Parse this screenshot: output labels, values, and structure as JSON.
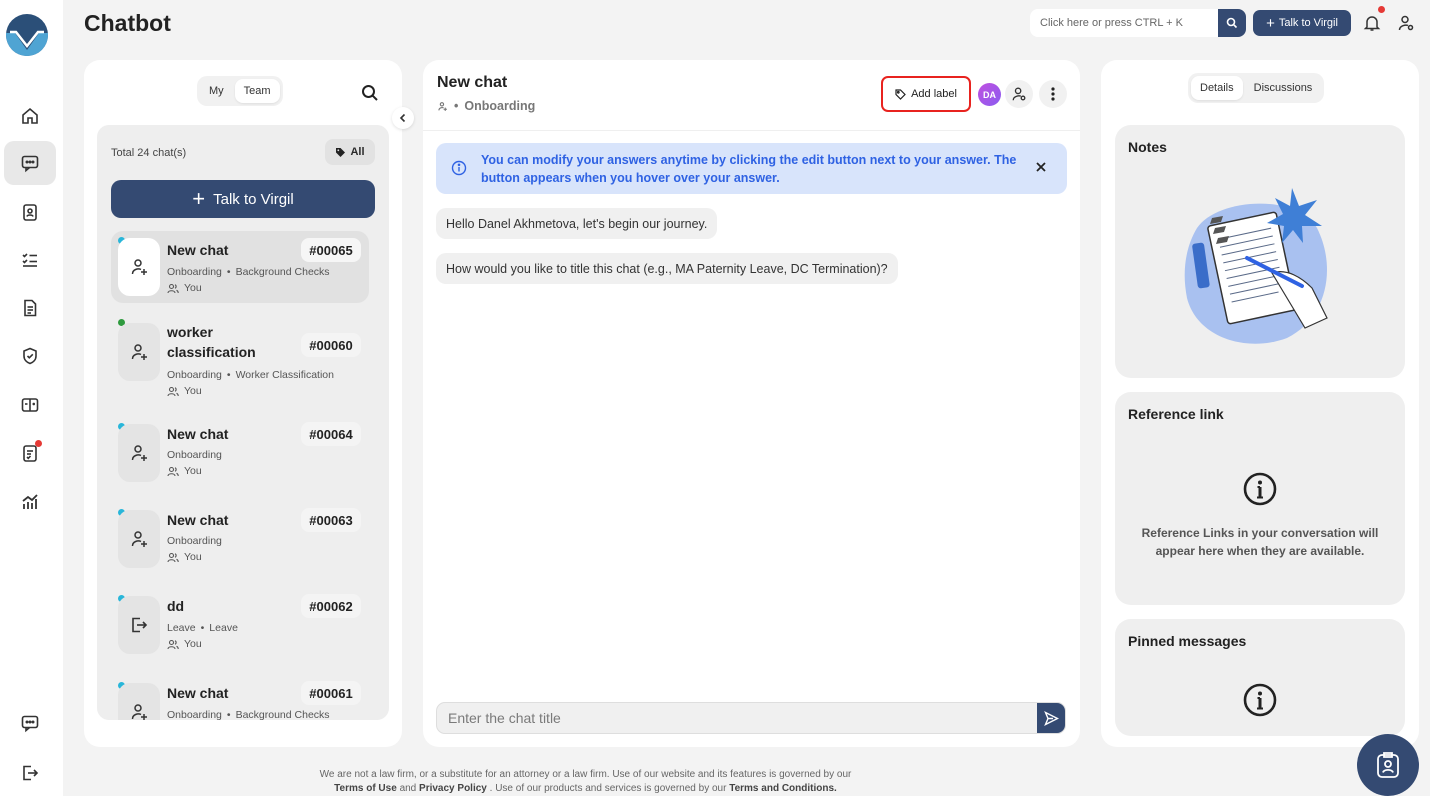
{
  "app": {
    "title": "Chatbot"
  },
  "header": {
    "search_placeholder": "Click here or press CTRL + K",
    "talk_button": "Talk to Virgil"
  },
  "left": {
    "tabs": [
      {
        "label": "My",
        "active": false
      },
      {
        "label": "Team",
        "active": true
      }
    ],
    "total": "Total 24 chat(s)",
    "filter": "All",
    "talk_button": "Talk to Virgil",
    "chats": [
      {
        "title": "New chat",
        "number": "#00065",
        "category": "Onboarding",
        "subcategory": "Background Checks",
        "owner": "You",
        "dot_color": "#29b6d9",
        "icon": "user-add-icon",
        "selected": true
      },
      {
        "title": "worker classification",
        "number": "#00060",
        "category": "Onboarding",
        "subcategory": "Worker Classification",
        "owner": "You",
        "dot_color": "#2e9a3e",
        "icon": "user-add-icon",
        "selected": false
      },
      {
        "title": "New chat",
        "number": "#00064",
        "category": "Onboarding",
        "subcategory": "",
        "owner": "You",
        "dot_color": "#29b6d9",
        "icon": "user-add-icon",
        "selected": false
      },
      {
        "title": "New chat",
        "number": "#00063",
        "category": "Onboarding",
        "subcategory": "",
        "owner": "You",
        "dot_color": "#29b6d9",
        "icon": "user-add-icon",
        "selected": false
      },
      {
        "title": "dd",
        "number": "#00062",
        "category": "Leave",
        "subcategory": "Leave",
        "owner": "You",
        "dot_color": "#29b6d9",
        "icon": "leave-icon",
        "selected": false
      },
      {
        "title": "New chat",
        "number": "#00061",
        "category": "Onboarding",
        "subcategory": "Background Checks",
        "owner": "You",
        "dot_color": "#29b6d9",
        "icon": "user-add-icon",
        "selected": false
      }
    ]
  },
  "chat": {
    "title": "New chat",
    "category": "Onboarding",
    "add_label": "Add label",
    "avatar_initials": "DA",
    "banner": "You can modify your answers anytime by clicking the edit button next to your answer. The button appears when you hover over your answer.",
    "messages": [
      "Hello Danel Akhmetova, let's begin our journey.",
      "How would you like to title this chat (e.g., MA Paternity Leave, DC Termination)?"
    ],
    "input_placeholder": "Enter the chat title"
  },
  "right": {
    "tabs": [
      {
        "label": "Details",
        "active": true
      },
      {
        "label": "Discussions",
        "active": false
      }
    ],
    "notes_title": "Notes",
    "reference_title": "Reference link",
    "reference_text": "Reference Links in your conversation will appear here when they are available.",
    "pinned_title": "Pinned messages"
  },
  "footer": {
    "line1": "We are not a law firm, or a substitute for an attorney or a law firm. Use of our website and its features is governed by our",
    "terms_of_use": "Terms of Use",
    "and": "and",
    "privacy": "Privacy Policy",
    "line2": ". Use of our products and services is governed by our",
    "terms_conditions": "Terms and Conditions."
  },
  "colors": {
    "brand": "#344a72",
    "accent_blue": "#2f62e3",
    "highlight_red": "#e8231f"
  }
}
